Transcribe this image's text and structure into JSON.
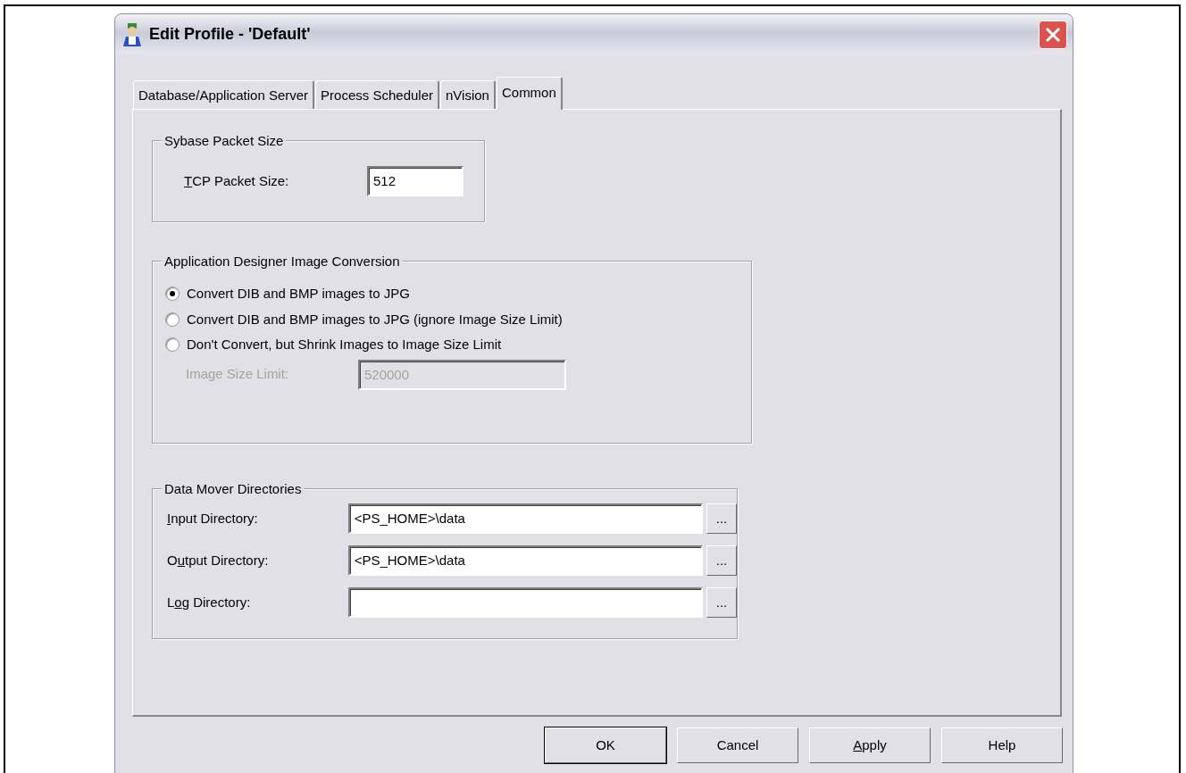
{
  "window": {
    "title": "Edit Profile - 'Default'"
  },
  "tabs": [
    {
      "label": "Database/Application Server",
      "selected": false
    },
    {
      "label": "Process Scheduler",
      "selected": false
    },
    {
      "label": "nVision",
      "selected": false
    },
    {
      "label": "Common",
      "selected": true
    }
  ],
  "sybase": {
    "title": "Sybase Packet Size",
    "label": {
      "key": "T",
      "after": "CP Packet Size:"
    },
    "value": "512"
  },
  "conversion": {
    "title": "Application Designer Image Conversion",
    "options": [
      {
        "label": "Convert DIB and BMP images to JPG",
        "selected": true
      },
      {
        "label": "Convert DIB and BMP images to JPG (ignore Image Size Limit)",
        "selected": false
      },
      {
        "label": "Don't Convert, but Shrink Images to Image Size Limit",
        "selected": false
      }
    ],
    "limit": {
      "label": "Image Size Limit:",
      "value": "520000",
      "disabled": true
    }
  },
  "directories": {
    "title": "Data Mover Directories",
    "rows": [
      {
        "label": {
          "key": "I",
          "after": "nput Directory:"
        },
        "value": "<PS_HOME>\\data",
        "browse": "..."
      },
      {
        "label": {
          "before": "O",
          "key": "u",
          "after": "tput Directory:"
        },
        "value": "<PS_HOME>\\data",
        "browse": "..."
      },
      {
        "label": {
          "before": "L",
          "key": "o",
          "after": "g Directory:"
        },
        "browse": "..."
      }
    ]
  },
  "buttons": [
    {
      "label": {
        "before": "OK"
      },
      "default": true
    },
    {
      "label": {
        "before": "Cancel"
      },
      "default": false
    },
    {
      "label": {
        "key": "A",
        "after": "pply"
      },
      "default": false
    },
    {
      "label": {
        "before": "Help"
      },
      "default": false
    }
  ]
}
